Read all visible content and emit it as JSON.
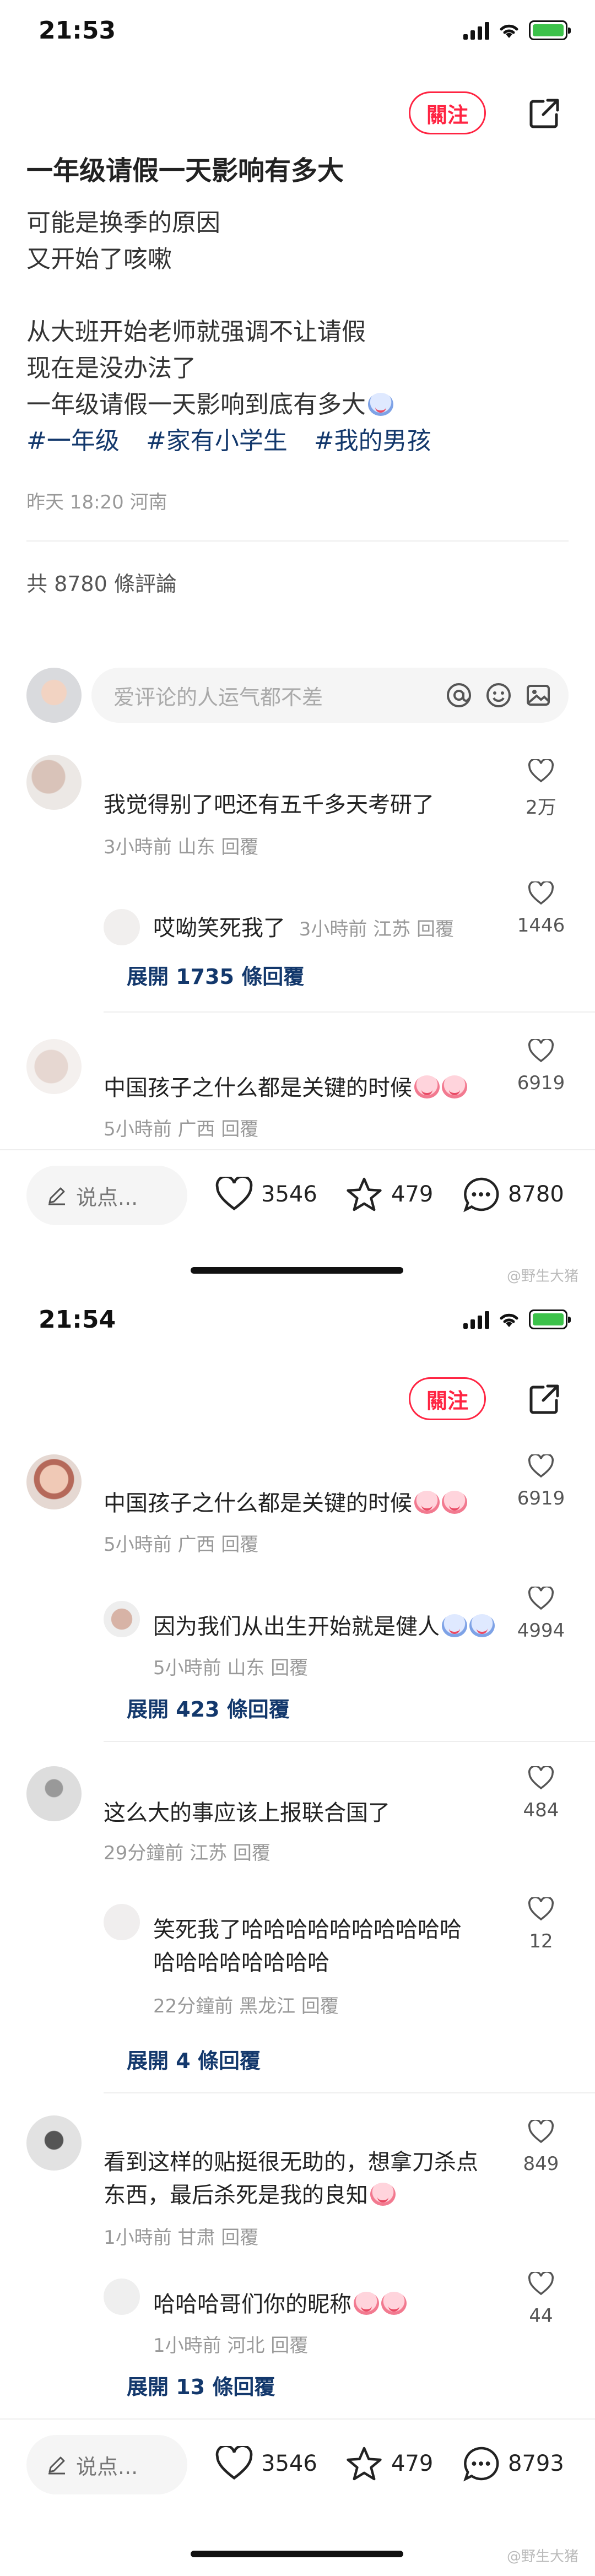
{
  "screen1": {
    "time": "21:53",
    "follow_label": "關注",
    "post": {
      "title": "一年级请假一天影响有多大",
      "lines": [
        "可能是换季的原因",
        "又开始了咳嗽",
        "",
        "从大班开始老师就强调不让请假",
        "现在是没办法了",
        "一年级请假一天影响到底有多大"
      ],
      "tags": [
        "#一年级",
        "#家有小学生",
        "#我的男孩"
      ],
      "meta": "昨天 18:20 河南"
    },
    "comment_count": "共 8780 條評論",
    "comment_placeholder": "爱评论的人运气都不差",
    "comments": [
      {
        "text": "我觉得别了吧还有五千多天考研了",
        "meta": "3小時前  山东  回覆",
        "likes": "2万"
      },
      {
        "text": "哎呦笑死我了",
        "meta_inline": "3小時前  江苏  回覆",
        "likes": "1446",
        "reply": true
      },
      {
        "expand": "展開 1735 條回覆"
      },
      {
        "text": "中国孩子之什么都是关键的时候",
        "meta": "5小時前  广西  回覆",
        "likes": "6919"
      }
    ],
    "bottom": {
      "say": "说点...",
      "likes": "3546",
      "stars": "479",
      "comments": "8780"
    }
  },
  "screen2": {
    "time": "21:54",
    "follow_label": "關注",
    "comments": [
      {
        "text": "中国孩子之什么都是关键的时候",
        "meta": "5小時前  广西  回覆",
        "likes": "6919"
      },
      {
        "text": "因为我们从出生开始就是健人",
        "meta": "5小時前  山东  回覆",
        "likes": "4994",
        "reply": true
      },
      {
        "expand": "展開 423 條回覆"
      },
      {
        "text": "这么大的事应该上报联合国了",
        "meta": "29分鐘前  江苏  回覆",
        "likes": "484"
      },
      {
        "text_lines": [
          "笑死我了哈哈哈哈哈哈哈哈哈哈",
          "哈哈哈哈哈哈哈哈"
        ],
        "meta": "22分鐘前  黑龙江  回覆",
        "likes": "12",
        "reply": true
      },
      {
        "expand": "展開 4 條回覆"
      },
      {
        "text_lines": [
          "看到这样的贴挺很无助的，想拿刀杀点",
          "东西，最后杀死是我的良知"
        ],
        "meta": "1小時前  甘肃  回覆",
        "likes": "849"
      },
      {
        "text": "哈哈哈哥们你的昵称",
        "meta": "1小時前  河北  回覆",
        "likes": "44",
        "reply": true
      },
      {
        "expand": "展開 13 條回覆"
      }
    ],
    "bottom": {
      "say": "说点...",
      "likes": "3546",
      "stars": "479",
      "comments": "8793"
    }
  },
  "watermark": "@野生大猪",
  "colors": {
    "accent": "#ff2442",
    "link": "#13386c"
  }
}
